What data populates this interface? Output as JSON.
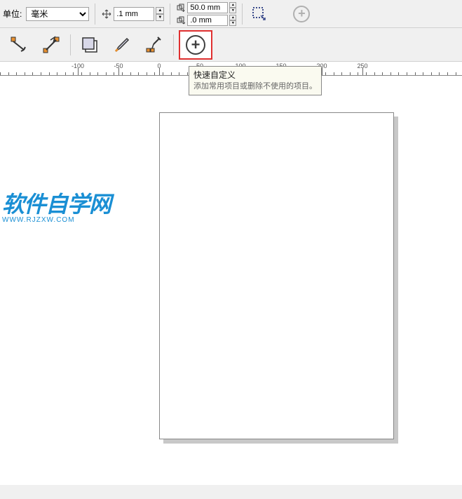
{
  "topbar": {
    "unit_label": "单位:",
    "unit_value": "毫米",
    "nudge_value": ".1 mm",
    "duplicate_x": "50.0 mm",
    "duplicate_y": ".0 mm"
  },
  "tooltip": {
    "title": "快速自定义",
    "desc": "添加常用项目或删除不使用的项目。"
  },
  "ruler": {
    "marks": [
      {
        "label": "-100",
        "pos": 111
      },
      {
        "label": "-50",
        "pos": 169
      },
      {
        "label": "0",
        "pos": 227
      },
      {
        "label": "50",
        "pos": 285
      },
      {
        "label": "100",
        "pos": 343
      },
      {
        "label": "150",
        "pos": 401
      },
      {
        "label": "200",
        "pos": 459
      },
      {
        "label": "250",
        "pos": 517
      }
    ]
  },
  "watermark": {
    "main": "软件自学网",
    "sub": "WWW.RJZXW.COM"
  },
  "icons": {
    "nudge": "nudge-offset-icon",
    "dup_x": "duplicate-x-icon",
    "dup_y": "duplicate-y-icon",
    "treat_objects": "treat-as-filled-icon",
    "plus_top": "quick-customize-icon",
    "snap_anchor": "snap-anchor-icon",
    "snap_segment": "snap-segment-icon",
    "bounding": "bounding-box-icon",
    "outline": "outline-tool-icon",
    "eyedropper": "eyedropper-icon",
    "plus_main": "quick-customize-icon"
  }
}
